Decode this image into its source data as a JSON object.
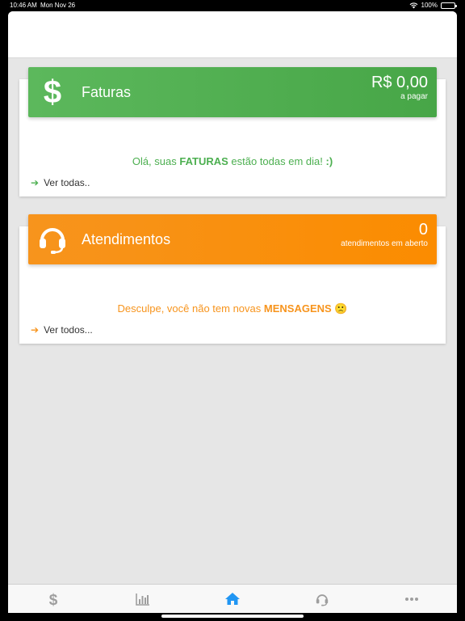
{
  "status_bar": {
    "time": "10:46 AM",
    "date": "Mon Nov 26",
    "battery": "100%"
  },
  "faturas": {
    "title": "Faturas",
    "amount": "R$ 0,00",
    "amount_sub": "a pagar",
    "message_prefix": "Olá, suas ",
    "message_bold": "FATURAS",
    "message_mid": " estão todas em dia! ",
    "message_end": ":)",
    "link": "Ver todas..",
    "icon": "dollar-icon",
    "color": "#5cb85c"
  },
  "atendimentos": {
    "title": "Atendimentos",
    "count": "0",
    "count_sub": "atendimentos em aberto",
    "message_prefix": "Desculpe, você não tem novas ",
    "message_bold": "MENSAGENS",
    "message_emoji": "🙁",
    "link": "Ver todos...",
    "icon": "headset-icon",
    "color": "#f7941d"
  },
  "tabs": [
    {
      "name": "tab-faturas",
      "icon": "dollar-icon",
      "active": false
    },
    {
      "name": "tab-charts",
      "icon": "bar-chart-icon",
      "active": false
    },
    {
      "name": "tab-home",
      "icon": "home-icon",
      "active": true
    },
    {
      "name": "tab-support",
      "icon": "headset-icon",
      "active": false
    },
    {
      "name": "tab-more",
      "icon": "more-icon",
      "active": false
    }
  ],
  "colors": {
    "active_tab": "#2196f3",
    "inactive_tab": "#9e9e9e"
  }
}
